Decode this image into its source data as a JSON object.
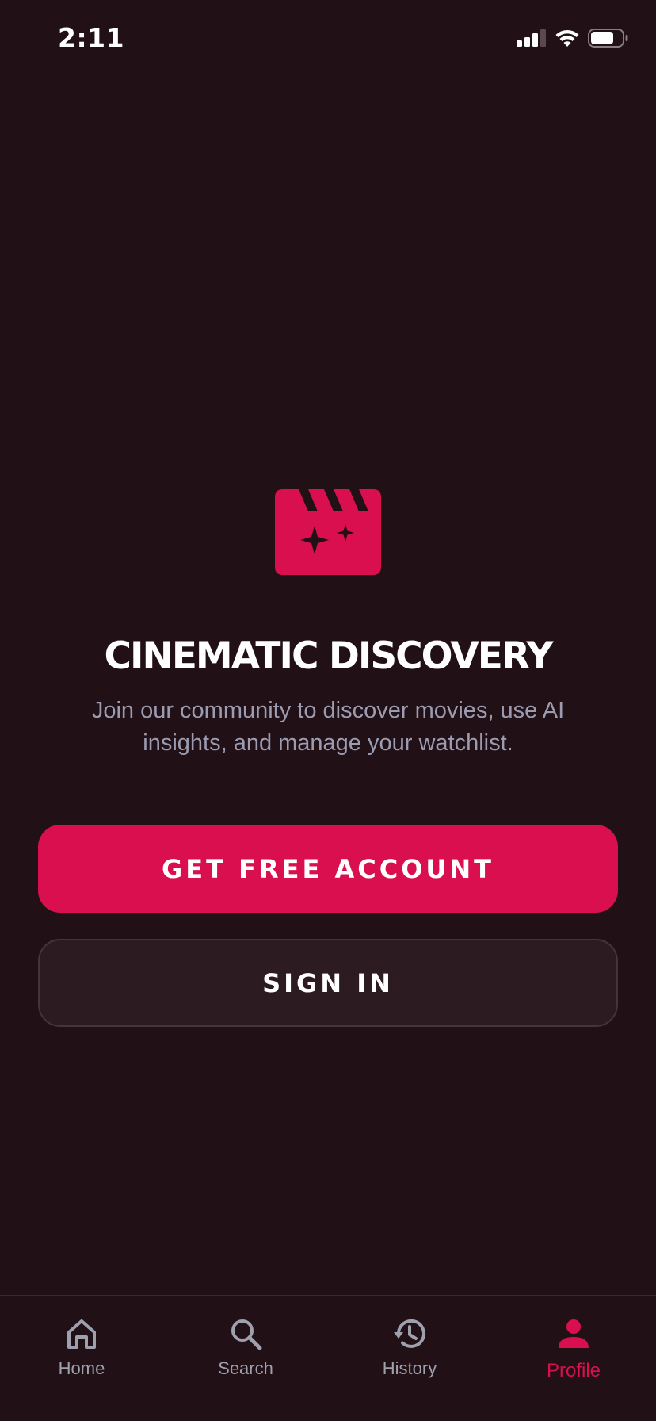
{
  "status_bar": {
    "time": "2:11"
  },
  "hero": {
    "icon": "clapperboard-sparkle-icon",
    "title": "CINEMATIC DISCOVERY",
    "subtitle": "Join our community to discover movies, use AI insights, and manage your watchlist."
  },
  "actions": {
    "primary_label": "GET FREE ACCOUNT",
    "secondary_label": "SIGN IN"
  },
  "bottom_nav": {
    "items": [
      {
        "label": "Home",
        "icon": "home-icon",
        "active": false
      },
      {
        "label": "Search",
        "icon": "search-icon",
        "active": false
      },
      {
        "label": "History",
        "icon": "history-icon",
        "active": false
      },
      {
        "label": "Profile",
        "icon": "profile-icon",
        "active": true
      }
    ]
  },
  "colors": {
    "background": "#211016",
    "accent": "#d90f4f",
    "secondary_button": "#2c1b21",
    "muted_text": "#9b9bb1"
  }
}
